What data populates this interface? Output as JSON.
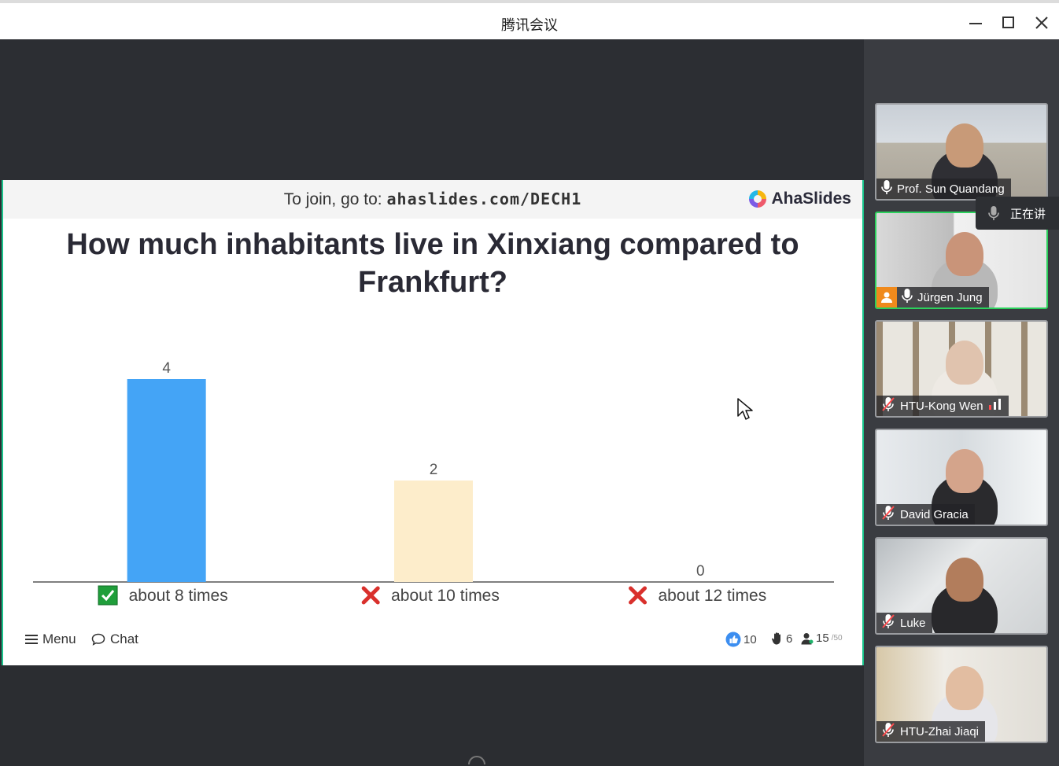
{
  "window": {
    "title": "腾讯会议"
  },
  "slide": {
    "join_prefix": "To join, go to:",
    "join_url": "ahaslides.com/DECH1",
    "brand": "AhaSlides",
    "question": "How much inhabitants live in Xinxiang compared to Frankfurt?",
    "footer": {
      "menu_label": "Menu",
      "chat_label": "Chat",
      "likes": "10",
      "hands": "6",
      "audience": "15",
      "audience_max": "/50"
    }
  },
  "chart_data": {
    "type": "bar",
    "categories": [
      "about 8 times",
      "about 10 times",
      "about 12 times"
    ],
    "values": [
      4,
      2,
      0
    ],
    "correct": [
      true,
      false,
      false
    ],
    "colors": [
      "#44a4f6",
      "#fdedcb",
      "#c0c0c0"
    ],
    "ylim": [
      0,
      4
    ]
  },
  "participants": [
    {
      "name": "Prof. Sun Quandang",
      "mic": "on"
    },
    {
      "name": "Jürgen Jung",
      "mic": "on",
      "active": true
    },
    {
      "name": "HTU-Kong Wen",
      "mic": "muted"
    },
    {
      "name": "David Gracia",
      "mic": "muted"
    },
    {
      "name": "Luke",
      "mic": "muted"
    },
    {
      "name": "HTU-Zhai Jiaqi",
      "mic": "muted"
    }
  ],
  "speaking_indicator": "正在讲"
}
